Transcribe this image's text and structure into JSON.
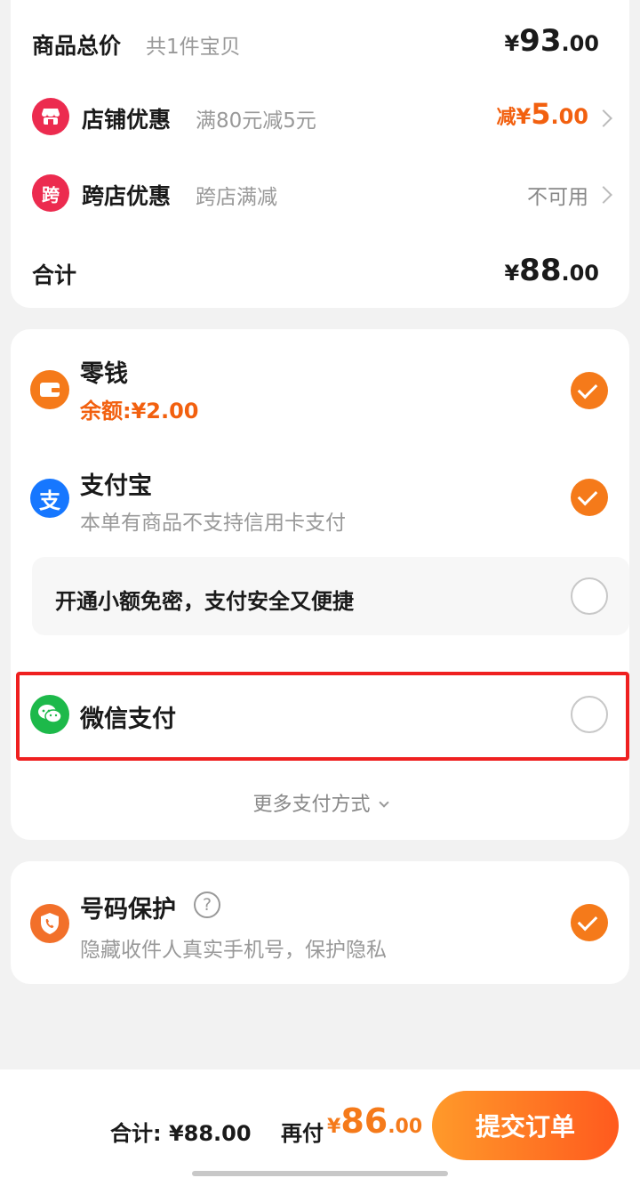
{
  "summary": {
    "goods_total_label": "商品总价",
    "goods_count": "共1件宝贝",
    "goods_total": {
      "yen": "¥",
      "int": "93",
      "dec": ".00"
    },
    "shop_discount_label": "店铺优惠",
    "shop_discount_desc": "满80元减5元",
    "shop_discount_value": {
      "prefix": "减",
      "yen": "¥",
      "int": "5",
      "dec": ".00"
    },
    "cross_discount_label": "跨店优惠",
    "cross_discount_desc": "跨店满减",
    "cross_discount_value": "不可用",
    "cross_icon_char": "跨",
    "total_label": "合计",
    "total": {
      "yen": "¥",
      "int": "88",
      "dec": ".00"
    }
  },
  "payment": {
    "change": {
      "title": "零钱",
      "balance": "余额:¥2.00",
      "selected": true,
      "icon": "wallet-icon"
    },
    "alipay": {
      "title": "支付宝",
      "note": "本单有商品不支持信用卡支付",
      "selected": true,
      "icon_char": "支"
    },
    "free_pay": {
      "label": "开通小额免密，支付安全又便捷",
      "selected": false
    },
    "wechat": {
      "title": "微信支付",
      "selected": false,
      "icon": "wechat-icon"
    },
    "more": "更多支付方式"
  },
  "protect": {
    "title": "号码保护",
    "desc": "隐藏收件人真实手机号，保护隐私",
    "selected": true
  },
  "bottom": {
    "total_text": "合计: ¥88.00",
    "pay_prefix": "再付",
    "pay": {
      "yen": "¥",
      "int": "86",
      "dec": ".00"
    },
    "submit": "提交订单"
  },
  "colors": {
    "accent": "#f57a1a",
    "discount": "#f2600f",
    "highlight": "#ef2020",
    "wechat": "#1db94a",
    "alipay": "#1677ff"
  }
}
